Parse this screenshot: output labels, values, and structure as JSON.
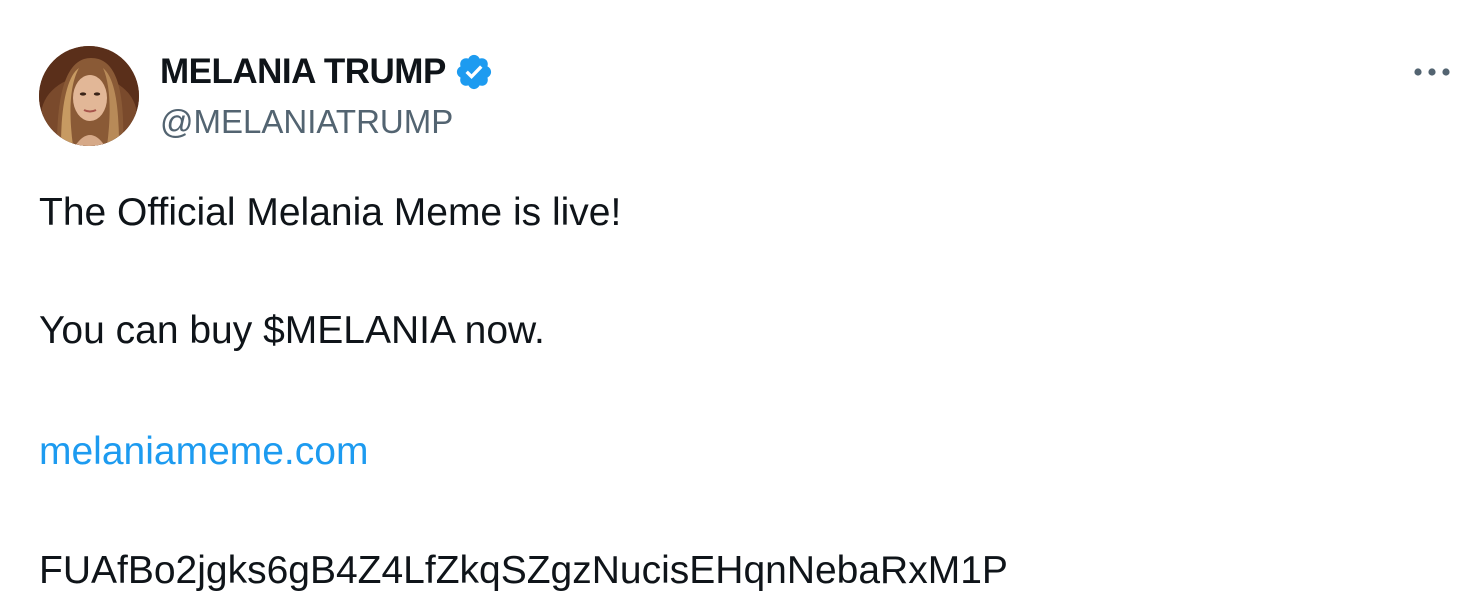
{
  "tweet": {
    "author": {
      "display_name": "MELANIA TRUMP",
      "handle": "@MELANIATRUMP",
      "verified": true,
      "verified_badge_color": "#1d9bf0"
    },
    "more_icon": "more-horizontal-icon",
    "body": {
      "line1": "The Official Melania Meme is live!",
      "line2": "You can buy $MELANIA now.",
      "link": "melaniameme.com",
      "line4": "FUAfBo2jgks6gB4Z4LfZkqSZgzNucisEHqnNebaRxM1P"
    },
    "colors": {
      "text": "#0f1419",
      "secondary": "#536471",
      "link": "#1d9bf0"
    }
  }
}
